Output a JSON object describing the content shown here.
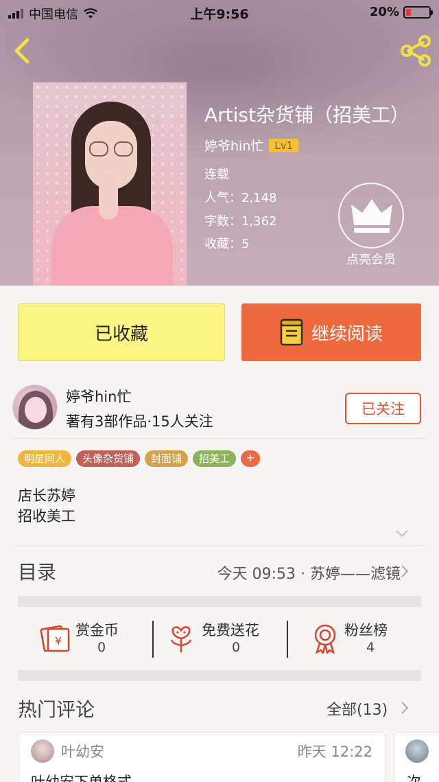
{
  "status_bar": {
    "carrier": "中国电信",
    "time": "上午9:56",
    "battery": "20%"
  },
  "book": {
    "title": "Artist杂货铺（招美工）",
    "author": "婷爷hin忙",
    "level": "Lv1",
    "status": "连载",
    "popularity": "人气：2,148",
    "word_count": "字数：1,362",
    "favorites": "收藏：5"
  },
  "vip": {
    "label": "点亮会员"
  },
  "actions": {
    "favorite_label": "已收藏",
    "read_label": "继续阅读"
  },
  "author_card": {
    "name": "婷爷hin忙",
    "info": "著有3部作品·15人关注",
    "follow_label": "已关注"
  },
  "tags": [
    {
      "label": "明星同人",
      "color": "#f0b53c"
    },
    {
      "label": "头像杂货铺",
      "color": "#c0615a"
    },
    {
      "label": "封面铺",
      "color": "#d4a24a"
    },
    {
      "label": "招美工",
      "color": "#8bb45a"
    }
  ],
  "tag_more": "+",
  "description": [
    "店长苏婷",
    "招收美工"
  ],
  "catalog": {
    "title": "目录",
    "latest": "今天 09:53 · 苏婷——滤镜"
  },
  "stats": [
    {
      "label": "赏金币",
      "value": "0",
      "icon": "coin-envelope-icon"
    },
    {
      "label": "免费送花",
      "value": "0",
      "icon": "flower-icon"
    },
    {
      "label": "粉丝榜",
      "value": "4",
      "icon": "medal-icon"
    }
  ],
  "comments": {
    "title": "热门评论",
    "all_label": "全部(13)",
    "items": [
      {
        "user": "叶幼安",
        "time": "昨天 12:22",
        "text": "叶幼安下单格式"
      },
      {
        "text": "次"
      }
    ]
  },
  "colors": {
    "accent_orange": "#ee6a3e",
    "fav_yellow": "#fdf486",
    "follow_red": "#e35434",
    "level_gold": "#f3c232"
  }
}
